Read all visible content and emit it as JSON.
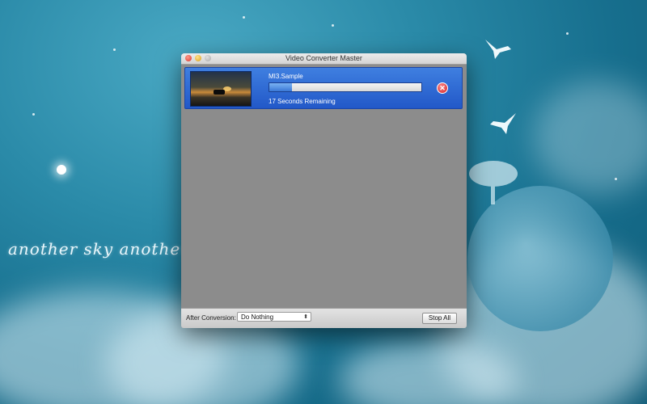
{
  "desktop": {
    "wallpaper_text": "another sky another wo"
  },
  "window": {
    "title": "Video Converter Master",
    "traffic_lights": [
      "close",
      "minimize",
      "zoom"
    ]
  },
  "job": {
    "name": "MI3.Sample",
    "progress": 0.15,
    "remaining": "17 Seconds Remaining",
    "cancel_icon": "close-circle-icon"
  },
  "footer": {
    "after_label": "After Conversion:",
    "after_value": "Do Nothing",
    "stop_label": "Stop All"
  },
  "colors": {
    "accent": "#2f6fd8",
    "cancel": "#d01f24"
  }
}
